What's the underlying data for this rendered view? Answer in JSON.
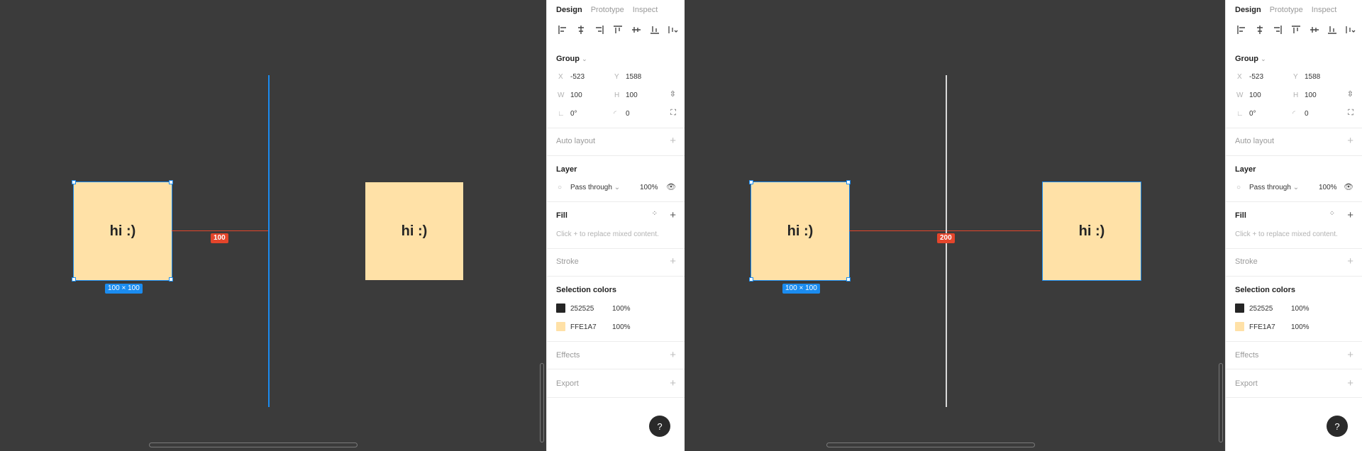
{
  "colors": {
    "canvas": "#3b3b3b",
    "frame_fill": "#FFE1A7",
    "selection_blue": "#1b8cf0",
    "measure_red": "#e4452b"
  },
  "left": {
    "canvas": {
      "frame1_text": "hi :)",
      "frame2_text": "hi :)",
      "size_label": "100 × 100",
      "distance_label": "100",
      "guide_color": "#1b8cf0"
    }
  },
  "right": {
    "canvas": {
      "frame1_text": "hi :)",
      "frame2_text": "hi :)",
      "size_label": "100 × 100",
      "distance_label": "200",
      "guide_color": "#d9d9d9"
    }
  },
  "panel": {
    "tabs": [
      "Design",
      "Prototype",
      "Inspect"
    ],
    "align_icons": [
      "align-left-icon",
      "align-horizontal-center-icon",
      "align-right-icon",
      "align-top-icon",
      "align-vertical-center-icon",
      "align-bottom-icon",
      "distribute-icon"
    ],
    "group": {
      "title": "Group",
      "x_label": "X",
      "x_value": "-523",
      "y_label": "Y",
      "y_value": "1588",
      "w_label": "W",
      "w_value": "100",
      "h_label": "H",
      "h_value": "100",
      "rotation_value": "0°",
      "radius_value": "0"
    },
    "auto_layout": "Auto layout",
    "layer": {
      "title": "Layer",
      "blend": "Pass through",
      "opacity": "100%"
    },
    "fill": {
      "title": "Fill",
      "hint": "Click + to replace mixed content."
    },
    "stroke": "Stroke",
    "selection_colors": {
      "title": "Selection colors",
      "items": [
        {
          "hex": "252525",
          "opacity": "100%",
          "color": "#252525"
        },
        {
          "hex": "FFE1A7",
          "opacity": "100%",
          "color": "#FFE1A7"
        }
      ]
    },
    "effects": "Effects",
    "export": "Export",
    "help": "?"
  }
}
